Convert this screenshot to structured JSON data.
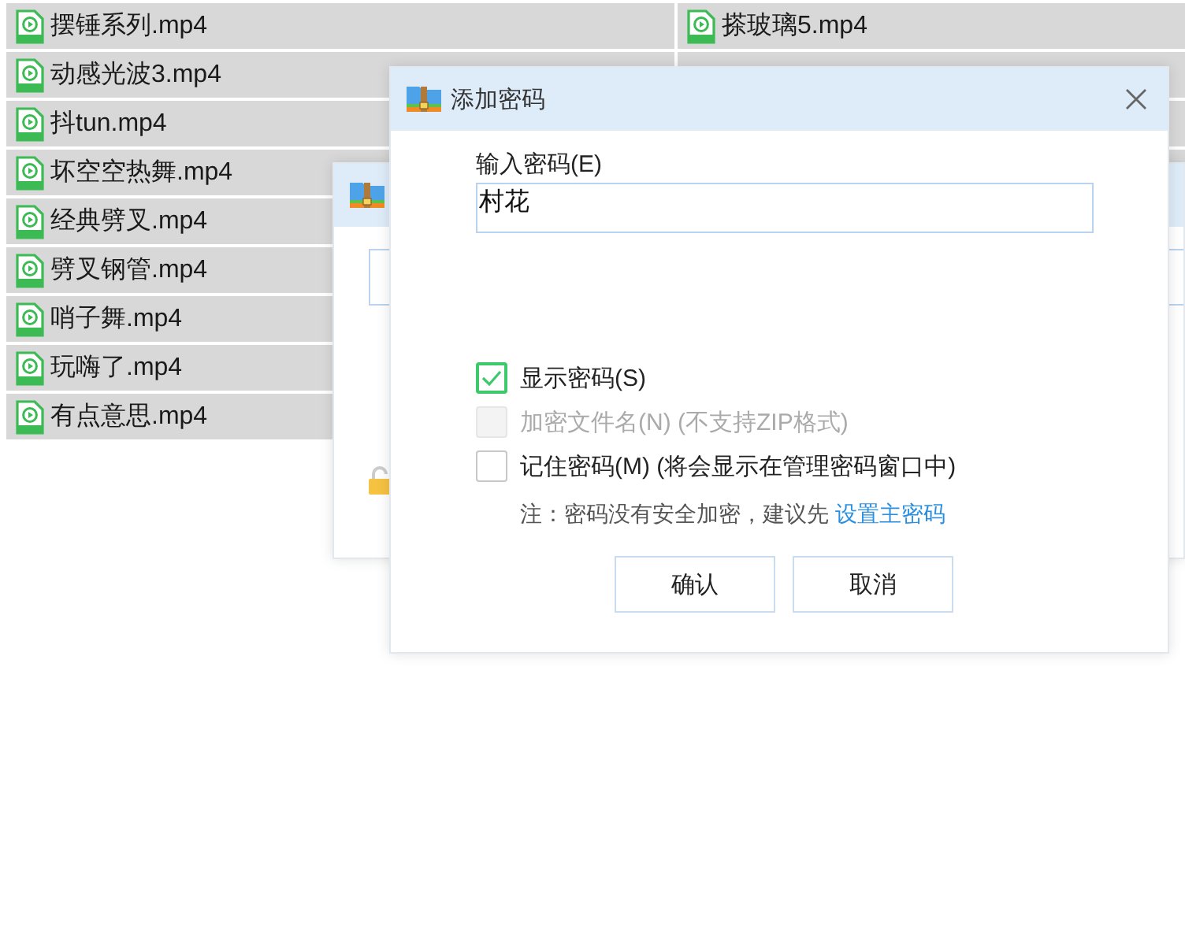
{
  "files_left": [
    "摆锤系列.mp4",
    "动感光波3.mp4",
    "抖tun.mp4",
    "坏空空热舞.mp4",
    "经典劈叉.mp4",
    "劈叉钢管.mp4",
    "哨子舞.mp4",
    "玩嗨了.mp4",
    "有点意思.mp4"
  ],
  "files_right": [
    "搽玻璃5.mp4"
  ],
  "dialog": {
    "title": "添加密码",
    "password_label": "输入密码(E)",
    "password_value": "村花",
    "options": [
      {
        "label": "显示密码(S)",
        "checked": true,
        "disabled": false
      },
      {
        "label": "加密文件名(N) (不支持ZIP格式)",
        "checked": false,
        "disabled": true
      },
      {
        "label": "记住密码(M) (将会显示在管理密码窗口中)",
        "checked": false,
        "disabled": false
      }
    ],
    "note": {
      "text": "注：密码没有安全加密，建议先",
      "link": "设置主密码"
    },
    "buttons": [
      "确认",
      "取消"
    ]
  }
}
